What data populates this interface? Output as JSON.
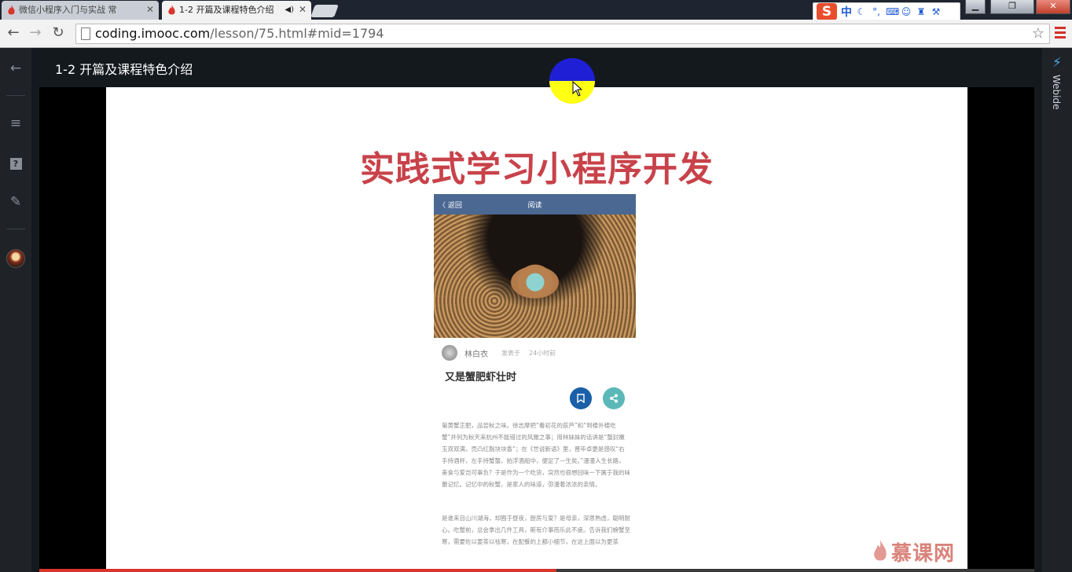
{
  "browser": {
    "tabs": [
      {
        "title": "微信小程序入门与实战 常",
        "close": "✕"
      },
      {
        "title": "1-2 开篇及课程特色介绍",
        "close": "✕",
        "audio_icon": "speaker-icon"
      }
    ],
    "url": {
      "host": "coding.imooc.com",
      "path": "/lesson/75.html#mid=1794"
    },
    "ime": {
      "logo": "S",
      "mode": "中"
    },
    "window_buttons": {
      "minimize": "▁",
      "restore": "❐",
      "close": "✕"
    }
  },
  "sidebar": {
    "back_icon": "←",
    "menu_icon": "≡",
    "question_icon": "?",
    "edit_icon": "✎"
  },
  "lesson": {
    "title": "1-2 开篇及课程特色介绍"
  },
  "right_panel": {
    "label": "Webide"
  },
  "slide": {
    "title": "实践式学习小程序开发",
    "phone": {
      "back": "〈 返回",
      "nav_title": "阅读",
      "author": "林白衣",
      "published": "发表于",
      "time": "24小时前",
      "headline": "又是蟹肥虾壮时",
      "bookmark_icon": "bookmark-icon",
      "share_icon": "share-icon",
      "paragraphs": [
        "菊黄蟹正肥，品尝秋之味。徐志摩把“看初花的荻芦”和“到楼外楼吃蟹”并列为秋天来杭州不能错过的风雅之事；用林妹妹的话讲是“螯封嫩玉双双满，壳凸红脂块块香”；在《世说新语》里，晋毕卓更是感叹“右手持酒杯，左手持蟹螯，拍浮酒船中，便足了一生矣。”漫漫人生长路，美食与爱岂可辜负？于是作为一个吃货，突然也很想回味一下属于我的味蕾记忆。记忆中的秋蟹，是家人的味道，弥漫着浓浓的亲情。",
        "是谁来自山川湖海，却囿于昼夜，厨房与爱？是母亲，深思熟虑，聪明耐心。吃蟹前，总会拿出几件工具，斯有介事而乐此不疲。告诉我们螃蟹至寒，需要佐以姜茶以祛寒，在配餐的上都小细节，在这上面以为更茶"
      ]
    },
    "logo_text": "慕课网"
  },
  "player": {
    "progress": 0.52
  }
}
